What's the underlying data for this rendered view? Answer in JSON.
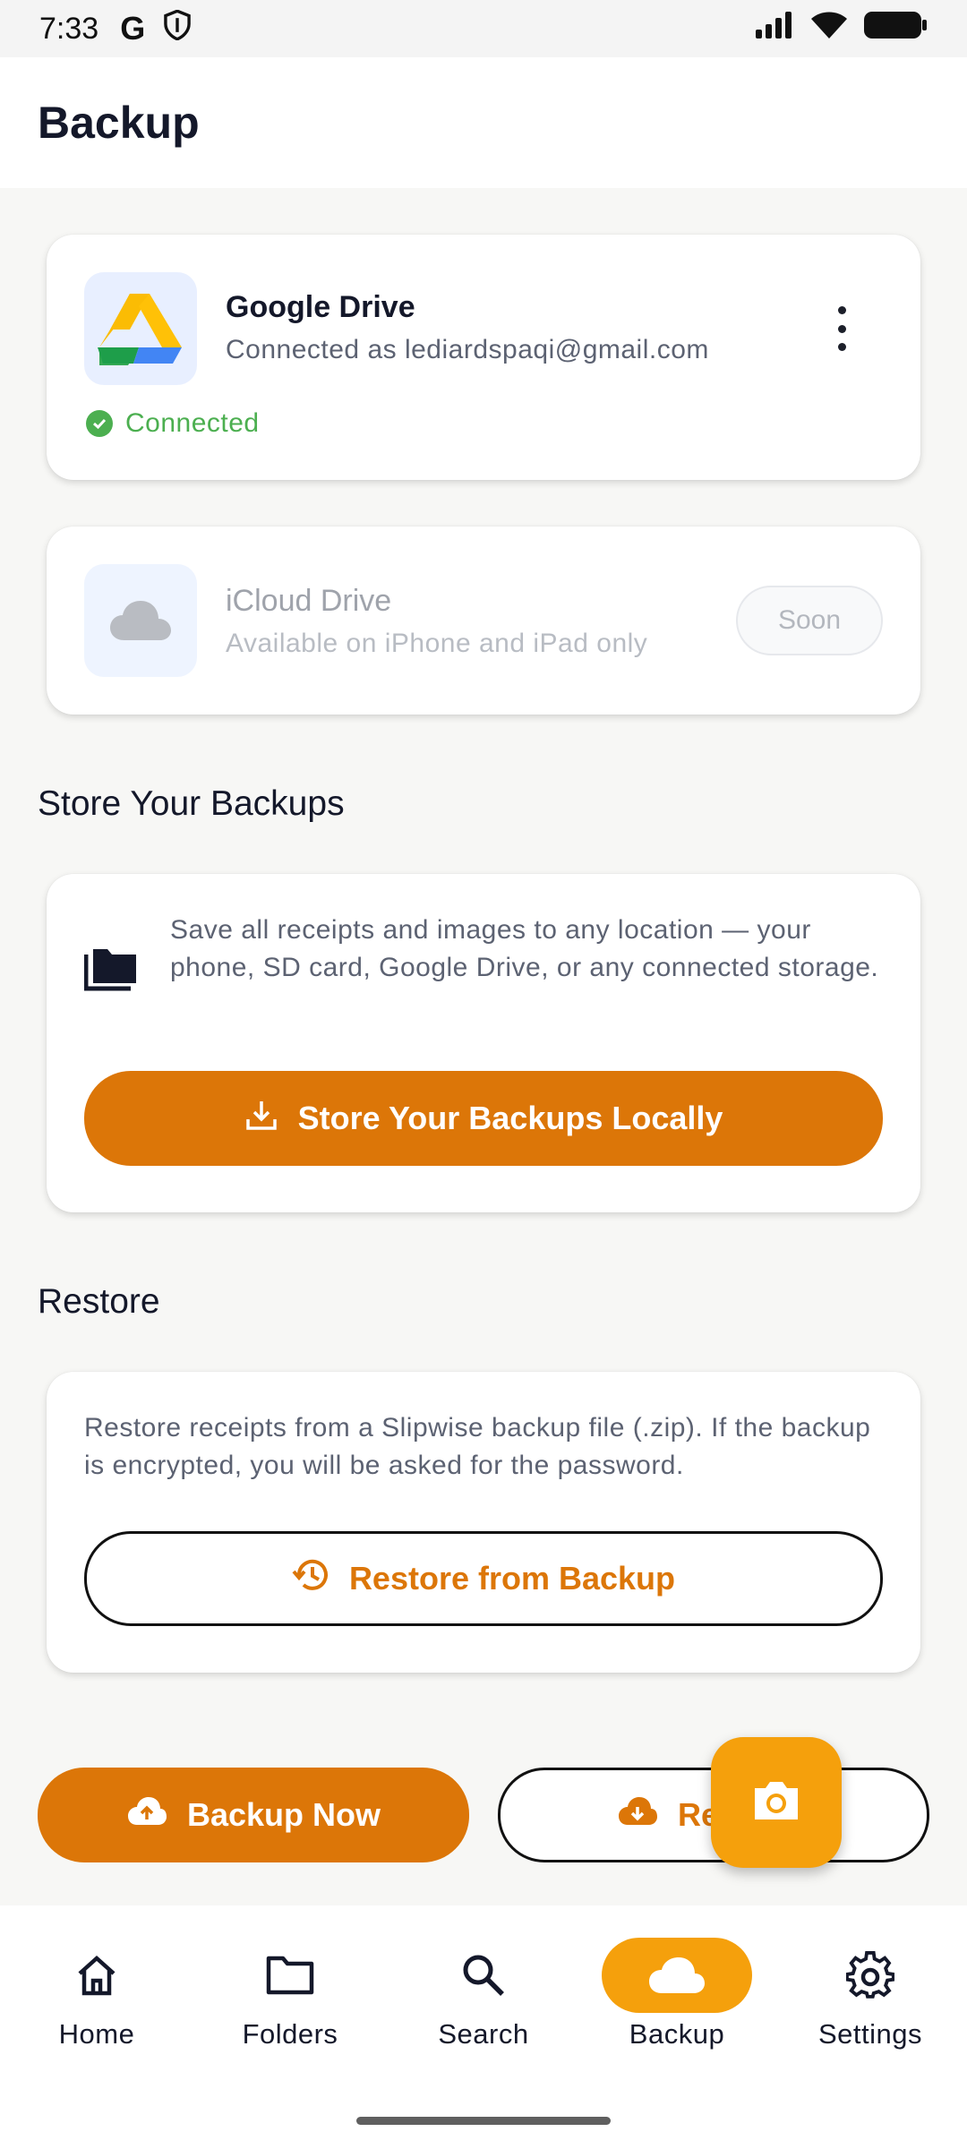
{
  "status_bar": {
    "time": "7:33",
    "google_letter": "G"
  },
  "app_bar": {
    "title": "Backup"
  },
  "google_drive": {
    "name": "Google Drive",
    "account": "Connected as lediardspaqi@gmail.com",
    "status": "Connected",
    "status_color": "#4caf50"
  },
  "icloud": {
    "name": "iCloud Drive",
    "sub": "Available on iPhone and iPad only",
    "chip": "Soon"
  },
  "store_section": {
    "title": "Store Your Backups",
    "description": "Save all receipts and images to any location — your phone, SD card, Google Drive, or any connected storage.",
    "button": "Store Your Backups Locally"
  },
  "restore_section": {
    "title": "Restore",
    "description": "Restore receipts from a Slipwise backup file (.zip). If the backup is encrypted, you will be asked for the password.",
    "button": "Restore from Backup"
  },
  "actions": {
    "backup_now": "Backup Now",
    "restore_partial": "Re"
  },
  "nav": {
    "items": [
      {
        "label": "Home",
        "icon": "home-icon"
      },
      {
        "label": "Folders",
        "icon": "folder-icon"
      },
      {
        "label": "Search",
        "icon": "search-icon"
      },
      {
        "label": "Backup",
        "icon": "cloud-icon"
      },
      {
        "label": "Settings",
        "icon": "gear-icon"
      }
    ],
    "active": "Backup"
  },
  "colors": {
    "accent": "#dc7608",
    "fab": "#f5a00c",
    "connected": "#4caf50"
  }
}
